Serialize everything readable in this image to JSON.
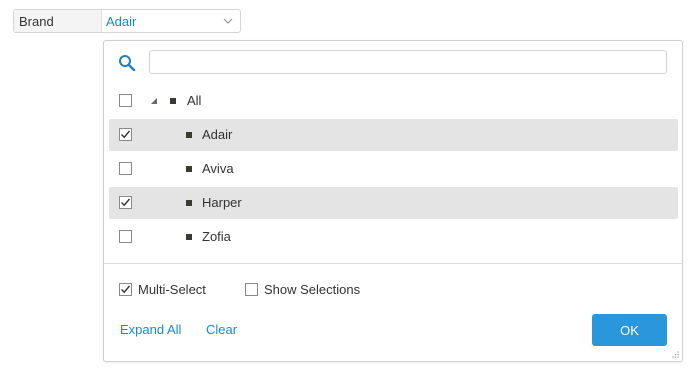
{
  "filter": {
    "label": "Brand",
    "value": "Adair"
  },
  "search": {
    "placeholder": ""
  },
  "tree": {
    "root": {
      "label": "All",
      "checked": false
    },
    "items": [
      {
        "label": "Adair",
        "checked": true
      },
      {
        "label": "Aviva",
        "checked": false
      },
      {
        "label": "Harper",
        "checked": true
      },
      {
        "label": "Zofia",
        "checked": false
      }
    ]
  },
  "options": {
    "multi_select": {
      "label": "Multi-Select",
      "checked": true
    },
    "show_selections": {
      "label": "Show Selections",
      "checked": false
    }
  },
  "actions": {
    "expand_all": "Expand All",
    "clear": "Clear",
    "ok": "OK"
  },
  "colors": {
    "accent": "#1a8ccd",
    "ok_button": "#2a96db",
    "selected_row": "#e4e4e4"
  },
  "icons": {
    "search": "search-icon",
    "chevron": "chevron-down-icon",
    "expander": "triangle-expanded-icon",
    "checkmark": "checkmark-icon",
    "resize": "resize-handle-icon"
  }
}
